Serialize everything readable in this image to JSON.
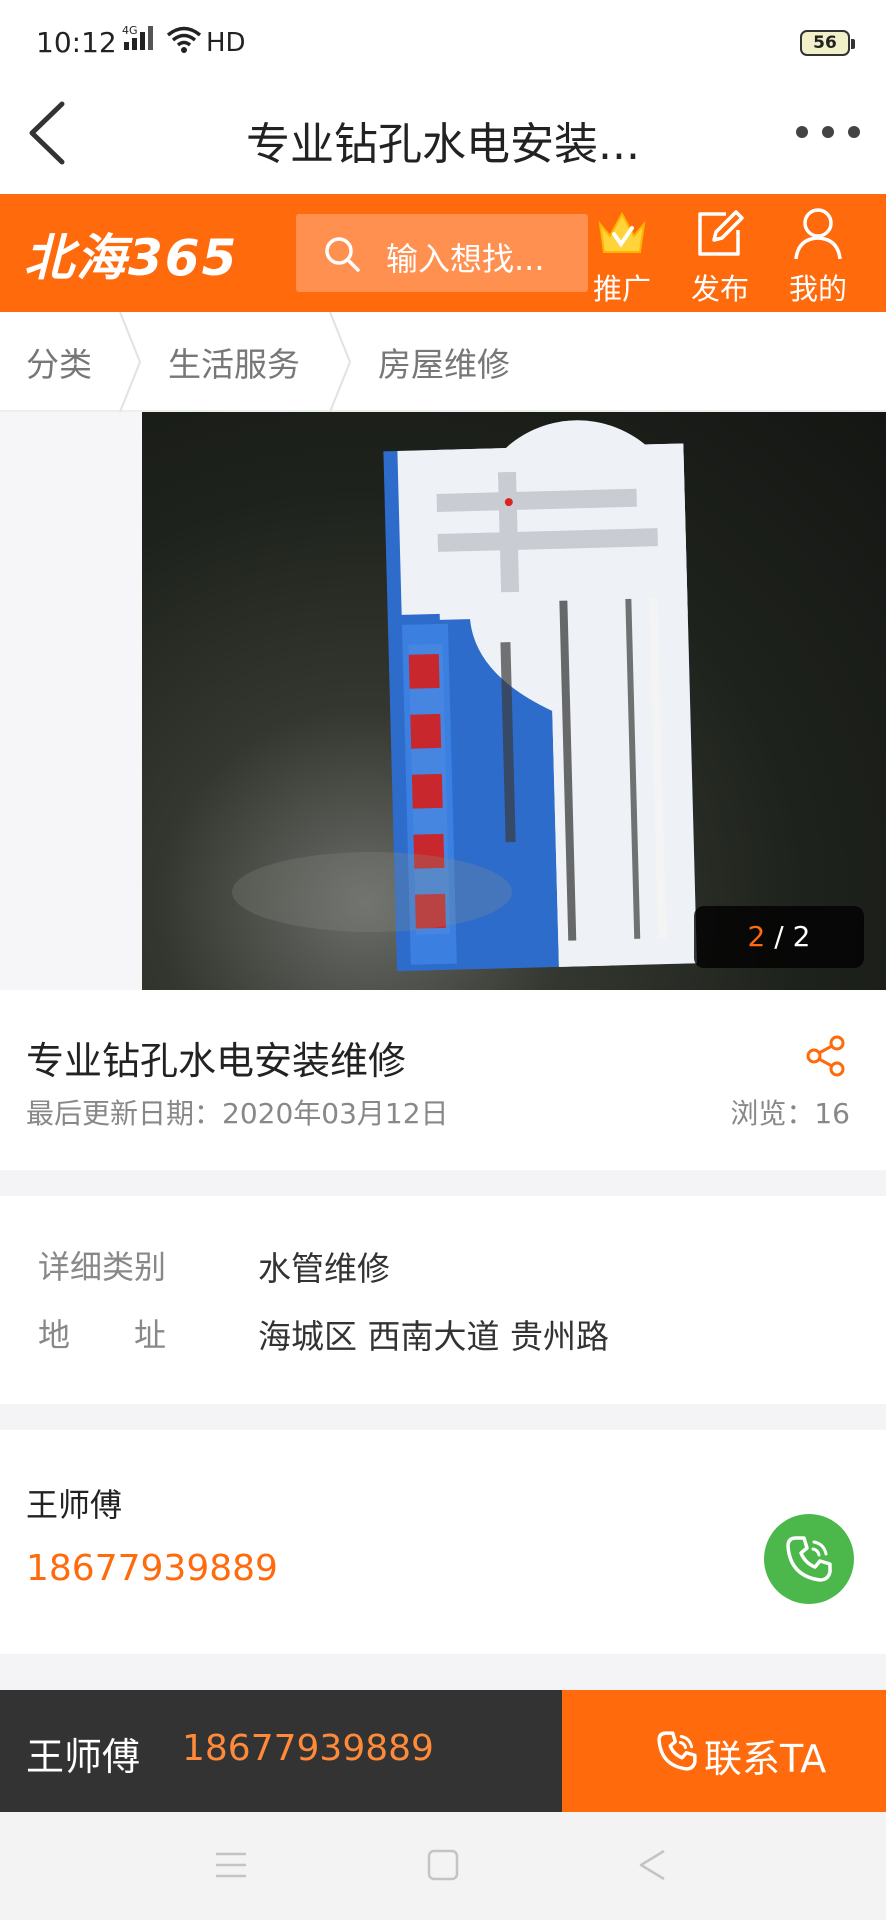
{
  "status": {
    "time": "10:12",
    "network": "4G",
    "hd": "HD",
    "battery": "56"
  },
  "titlebar": {
    "title": "专业钻孔水电安装..."
  },
  "header": {
    "logo": "北海365",
    "search_placeholder": "输入想找...",
    "nav": [
      {
        "label": "推广",
        "icon": "crown-icon"
      },
      {
        "label": "发布",
        "icon": "edit-icon"
      },
      {
        "label": "我的",
        "icon": "user-icon"
      }
    ]
  },
  "breadcrumb": [
    "分类",
    "生活服务",
    "房屋维修"
  ],
  "gallery": {
    "current": "2",
    "separator": " / ",
    "total": "2"
  },
  "post": {
    "title": "专业钻孔水电安装维修",
    "updated": "最后更新日期：2020年03月12日",
    "views": "浏览：16"
  },
  "details": [
    {
      "label": "详细类别",
      "value": "水管维修"
    },
    {
      "label": "地　　址",
      "value": "海城区 西南大道 贵州路"
    }
  ],
  "contact": {
    "name": "王师傅",
    "phone": "18677939889"
  },
  "bottom": {
    "name": "王师傅",
    "phone": "18677939889",
    "button": "联系TA"
  },
  "colors": {
    "brand": "#ff6a0d",
    "call_green": "#4cb84c",
    "dark_bar": "#333333"
  }
}
